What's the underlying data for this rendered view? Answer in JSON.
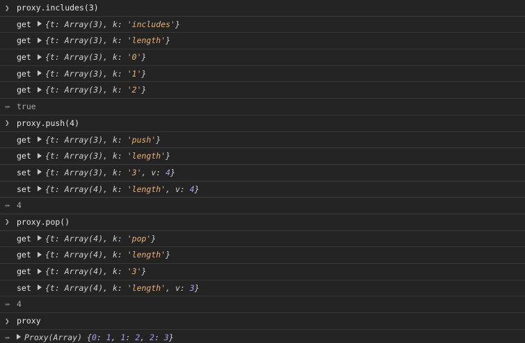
{
  "entries": [
    {
      "kind": "input",
      "text": "proxy.includes(3)"
    },
    {
      "kind": "log",
      "method": "get",
      "object": "{t: Array(3), k: 'includes'}"
    },
    {
      "kind": "log",
      "method": "get",
      "object": "{t: Array(3), k: 'length'}"
    },
    {
      "kind": "log",
      "method": "get",
      "object": "{t: Array(3), k: '0'}"
    },
    {
      "kind": "log",
      "method": "get",
      "object": "{t: Array(3), k: '1'}"
    },
    {
      "kind": "log",
      "method": "get",
      "object": "{t: Array(3), k: '2'}"
    },
    {
      "kind": "result",
      "text": "true"
    },
    {
      "kind": "input",
      "text": "proxy.push(4)"
    },
    {
      "kind": "log",
      "method": "get",
      "object": "{t: Array(3), k: 'push'}"
    },
    {
      "kind": "log",
      "method": "get",
      "object": "{t: Array(3), k: 'length'}"
    },
    {
      "kind": "log",
      "method": "set",
      "object": "{t: Array(3), k: '3', v: 4}"
    },
    {
      "kind": "log",
      "method": "set",
      "object": "{t: Array(4), k: 'length', v: 4}"
    },
    {
      "kind": "result",
      "text": "4"
    },
    {
      "kind": "input",
      "text": "proxy.pop()"
    },
    {
      "kind": "log",
      "method": "get",
      "object": "{t: Array(4), k: 'pop'}"
    },
    {
      "kind": "log",
      "method": "get",
      "object": "{t: Array(4), k: 'length'}"
    },
    {
      "kind": "log",
      "method": "get",
      "object": "{t: Array(4), k: '3'}"
    },
    {
      "kind": "log",
      "method": "set",
      "object": "{t: Array(4), k: 'length', v: 3}"
    },
    {
      "kind": "result",
      "text": "4"
    },
    {
      "kind": "input",
      "text": "proxy"
    },
    {
      "kind": "result-object",
      "text": "Proxy(Array) {0: 1, 1: 2, 2: 3}"
    }
  ],
  "icons": {
    "prompt": "chevron-right-icon",
    "result": "return-arrow-icon",
    "expand": "expand-triangle-icon"
  },
  "colors": {
    "background": "#242424",
    "separator": "#3a3a3a",
    "string": "#e8b27a",
    "number": "#a99cf5"
  }
}
